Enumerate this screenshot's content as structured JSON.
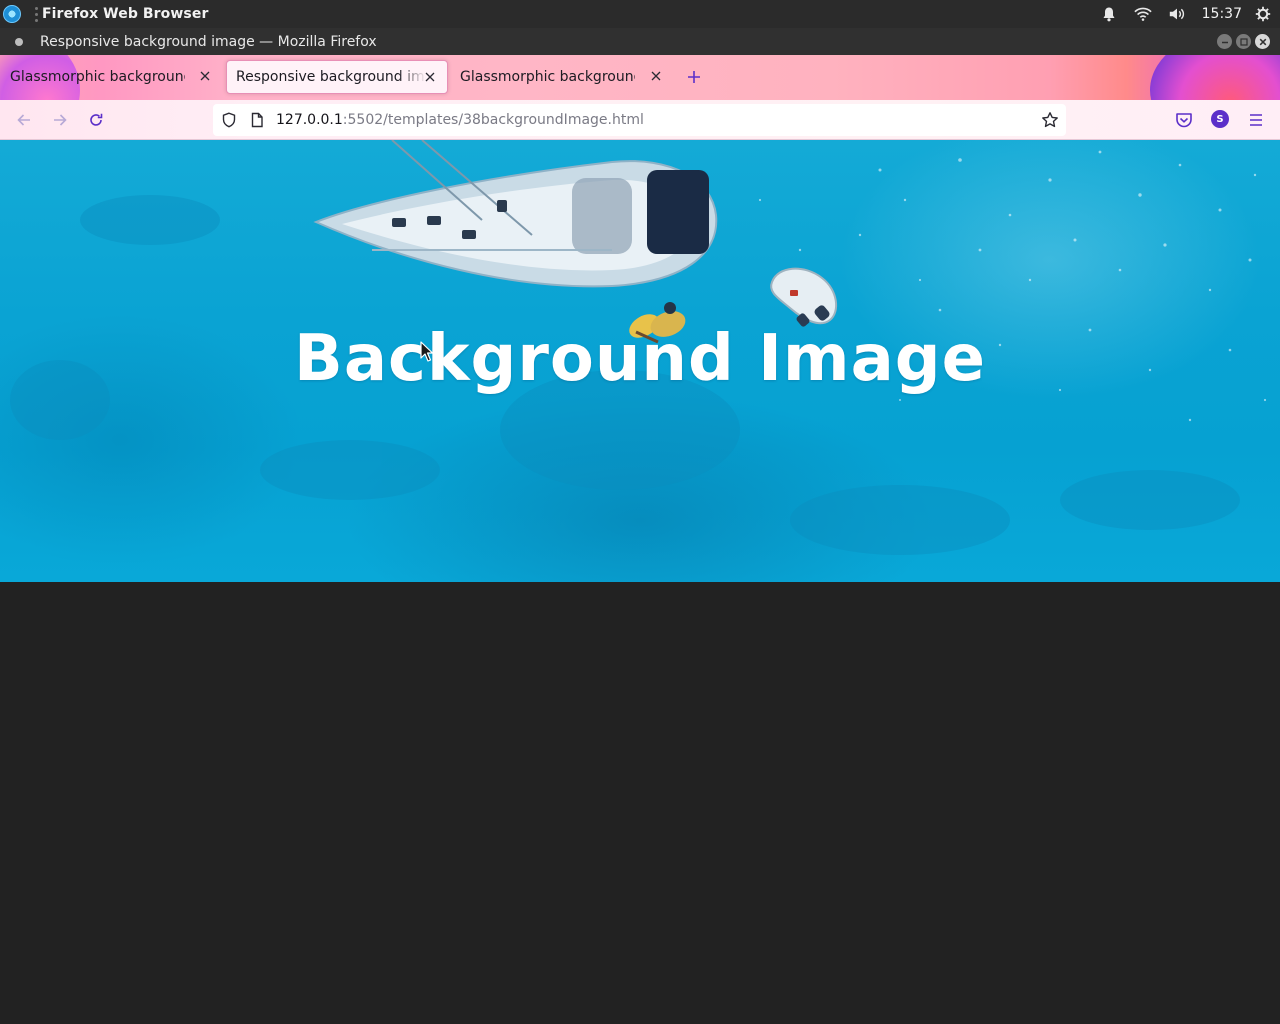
{
  "system_panel": {
    "app_name": "Firefox Web Browser",
    "clock": "15:37",
    "icons": [
      "notification-bell-icon",
      "wifi-icon",
      "volume-icon",
      "power-settings-icon"
    ]
  },
  "window": {
    "title": "Responsive background image — Mozilla Firefox"
  },
  "tabs": [
    {
      "label": "Glassmorphic background",
      "active": false
    },
    {
      "label": "Responsive background image",
      "active": true
    },
    {
      "label": "Glassmorphic background",
      "active": false
    }
  ],
  "navbar": {
    "url_host": "127.0.0.1",
    "url_path": ":5502/templates/38backgroundImage.html",
    "account_initial": "S"
  },
  "page": {
    "hero_title": "Background Image"
  },
  "colors": {
    "hero_water": "#0aa3d3",
    "page_background": "#222222",
    "accent": "#5b2fc9"
  }
}
